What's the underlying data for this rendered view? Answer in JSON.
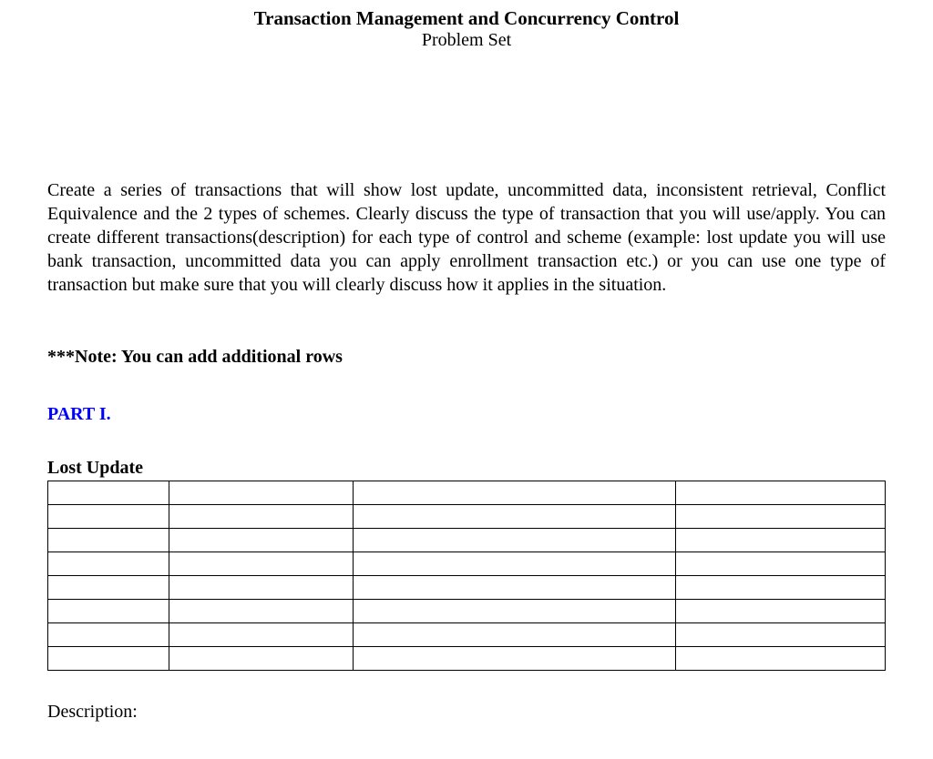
{
  "header": {
    "title": "Transaction Management and Concurrency Control",
    "subtitle": "Problem Set"
  },
  "instructions": "Create a series of transactions that will show lost update, uncommitted data, inconsistent retrieval, Conflict Equivalence and the 2 types of schemes. Clearly discuss the type of transaction that you will use/apply. You can create different transactions(description) for each type of control and scheme (example: lost update you will use bank transaction, uncommitted data you can apply enrollment transaction etc.) or you can use one type of transaction but make sure that you will clearly discuss how it applies in the situation.",
  "note": "***Note: You can add additional rows",
  "part_label": "PART I.",
  "section": {
    "title": "Lost Update",
    "rows": 8,
    "cols": 4
  },
  "description_label": "Description:"
}
